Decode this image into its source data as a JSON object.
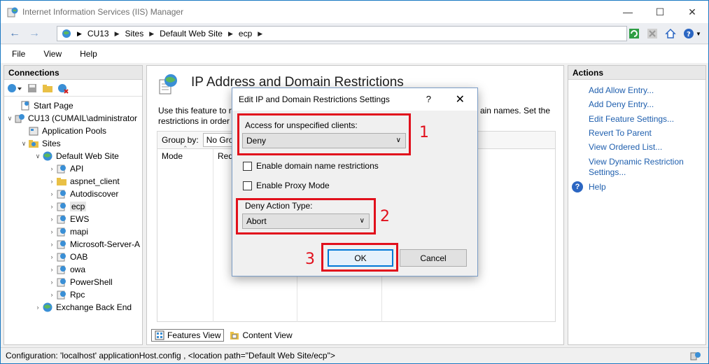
{
  "window": {
    "title": "Internet Information Services (IIS) Manager"
  },
  "titlebar": {
    "minimize": "—",
    "maximize": "☐",
    "close": "✕"
  },
  "address": {
    "crumbs": [
      "CU13",
      "Sites",
      "Default Web Site",
      "ecp"
    ]
  },
  "menu": [
    "File",
    "View",
    "Help"
  ],
  "connections": {
    "title": "Connections",
    "tree": [
      {
        "label": "Start Page"
      },
      {
        "label": "CU13 (CUMAIL\\administrator"
      },
      {
        "label": "Application Pools"
      },
      {
        "label": "Sites"
      },
      {
        "label": "Default Web Site"
      },
      {
        "label": "API"
      },
      {
        "label": "aspnet_client"
      },
      {
        "label": "Autodiscover"
      },
      {
        "label": "ecp"
      },
      {
        "label": "EWS"
      },
      {
        "label": "mapi"
      },
      {
        "label": "Microsoft-Server-A"
      },
      {
        "label": "OAB"
      },
      {
        "label": "owa"
      },
      {
        "label": "PowerShell"
      },
      {
        "label": "Rpc"
      },
      {
        "label": "Exchange Back End"
      }
    ]
  },
  "main": {
    "title": "IP Address and Domain Restrictions",
    "desc_line1": "Use this feature to re",
    "desc_line1_right": "ain names. Set the",
    "desc_line2": "restrictions in order",
    "groupby_label": "Group by:",
    "groupby_value": "No Gro",
    "col_mode": "Mode",
    "col_req": "Req",
    "features_view": "Features View",
    "content_view": "Content View"
  },
  "actions": {
    "title": "Actions",
    "items": [
      "Add Allow Entry...",
      "Add Deny Entry...",
      "Edit Feature Settings...",
      "Revert To Parent",
      "View Ordered List...",
      "View Dynamic Restriction Settings..."
    ],
    "help": "Help"
  },
  "status": {
    "text": "Configuration: 'localhost' applicationHost.config , <location path=\"Default Web Site/ecp\">"
  },
  "dialog": {
    "title": "Edit IP and Domain Restrictions Settings",
    "help_glyph": "?",
    "close_glyph": "✕",
    "access_label": "Access for unspecified clients:",
    "access_value": "Deny",
    "enable_domain": "Enable domain name restrictions",
    "enable_proxy": "Enable Proxy Mode",
    "deny_action_label": "Deny Action Type:",
    "deny_action_value": "Abort",
    "ok": "OK",
    "cancel": "Cancel"
  },
  "annotations": {
    "one": "1",
    "two": "2",
    "three": "3"
  },
  "colors": {
    "accent": "#0078d7",
    "annotation_red": "#e1101c",
    "link": "#1f5fae"
  }
}
